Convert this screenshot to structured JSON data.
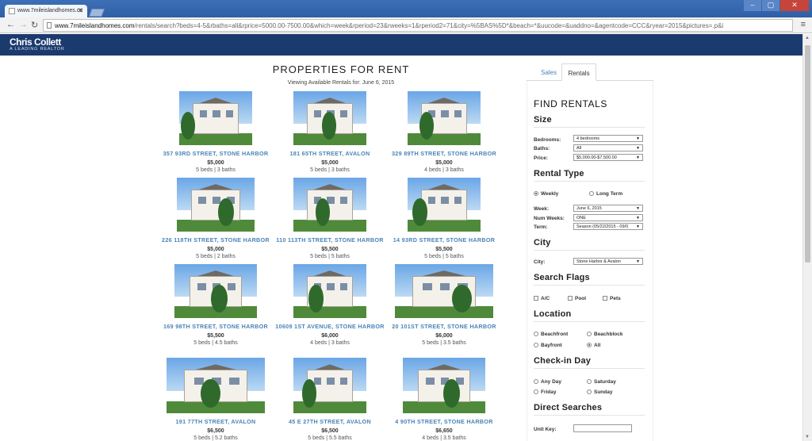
{
  "browser": {
    "tab_title": "www.7mileislandhomes.co",
    "url_host": "www.7mileislandhomes.com",
    "url_path": "/rentals/search?beds=4-5&rbaths=all&rprice=5000.00-7500.00&which=week&rperiod=23&rweeks=1&rperiod2=71&city=%5BAS%5D*&beach=*&uucode=&uaddno=&agentcode=CCC&ryear=2015&pictures=.p&i"
  },
  "site": {
    "logo": "Chris Collett",
    "logo_sub": "A LEADING REALTOR"
  },
  "listing": {
    "heading": "PROPERTIES FOR RENT",
    "viewing": "Viewing Available Rentals for: June 6, 2015",
    "properties": [
      {
        "title": "357 93RD STREET, STONE HARBOR",
        "price": "$5,000",
        "beds": "5 beds | 3 baths"
      },
      {
        "title": "181 65TH STREET, AVALON",
        "price": "$5,000",
        "beds": "5 beds | 3 baths"
      },
      {
        "title": "329 89TH STREET, STONE HARBOR",
        "price": "$5,000",
        "beds": "4 beds | 3 baths"
      },
      {
        "title": "226 118TH STREET, STONE HARBOR",
        "price": "$5,000",
        "beds": "5 beds | 2 baths"
      },
      {
        "title": "110 113TH STREET, STONE HARBOR",
        "price": "$5,500",
        "beds": "5 beds | 5 baths"
      },
      {
        "title": "14 93RD STREET, STONE HARBOR",
        "price": "$5,500",
        "beds": "5 beds | 5 baths"
      },
      {
        "title": "169 98TH STREET, STONE HARBOR",
        "price": "$5,500",
        "beds": "5 beds | 4.5 baths"
      },
      {
        "title": "10609 1ST AVENUE, STONE HARBOR",
        "price": "$6,000",
        "beds": "4 beds | 3 baths"
      },
      {
        "title": "20 101ST STREET, STONE HARBOR",
        "price": "$6,000",
        "beds": "5 beds | 3.5 baths"
      },
      {
        "title": "191 77TH STREET, AVALON",
        "price": "$6,500",
        "beds": "5 beds | 5.2 baths"
      },
      {
        "title": "45 E 27TH STREET, AVALON",
        "price": "$6,500",
        "beds": "5 beds | 5.5 baths"
      },
      {
        "title": "4 90TH STREET, STONE HARBOR",
        "price": "$6,650",
        "beds": "4 beds | 3.5 baths"
      }
    ]
  },
  "sidebar": {
    "tab_sales": "Sales",
    "tab_rentals": "Rentals",
    "heading": "FIND RENTALS",
    "size": {
      "title": "Size",
      "bedrooms_label": "Bedrooms:",
      "bedrooms_value": "4 bedrooms",
      "baths_label": "Baths:",
      "baths_value": "All",
      "price_label": "Price:",
      "price_value": "$5,000.00-$7,500.00"
    },
    "rental_type": {
      "title": "Rental Type",
      "weekly": "Weekly",
      "long_term": "Long Term",
      "week_label": "Week:",
      "week_value": "June 6, 2015",
      "num_weeks_label": "Num Weeks:",
      "num_weeks_value": "ONE",
      "term_label": "Term:",
      "term_value": "Season (05/22/2015 - 09/0"
    },
    "city": {
      "title": "City",
      "label": "City:",
      "value": "Stone Harbor & Avalon"
    },
    "flags": {
      "title": "Search Flags",
      "ac": "A/C",
      "pool": "Pool",
      "pets": "Pets"
    },
    "location": {
      "title": "Location",
      "beachfront": "Beachfront",
      "beachblock": "Beachblock",
      "bayfront": "Bayfront",
      "all": "All"
    },
    "checkin": {
      "title": "Check-in Day",
      "any": "Any Day",
      "saturday": "Saturday",
      "friday": "Friday",
      "sunday": "Sunday"
    },
    "direct": {
      "title": "Direct Searches",
      "unit_key_label": "Unit Key:"
    }
  },
  "colors": {
    "header": "#1b3a6d",
    "link": "#4a84b8"
  }
}
